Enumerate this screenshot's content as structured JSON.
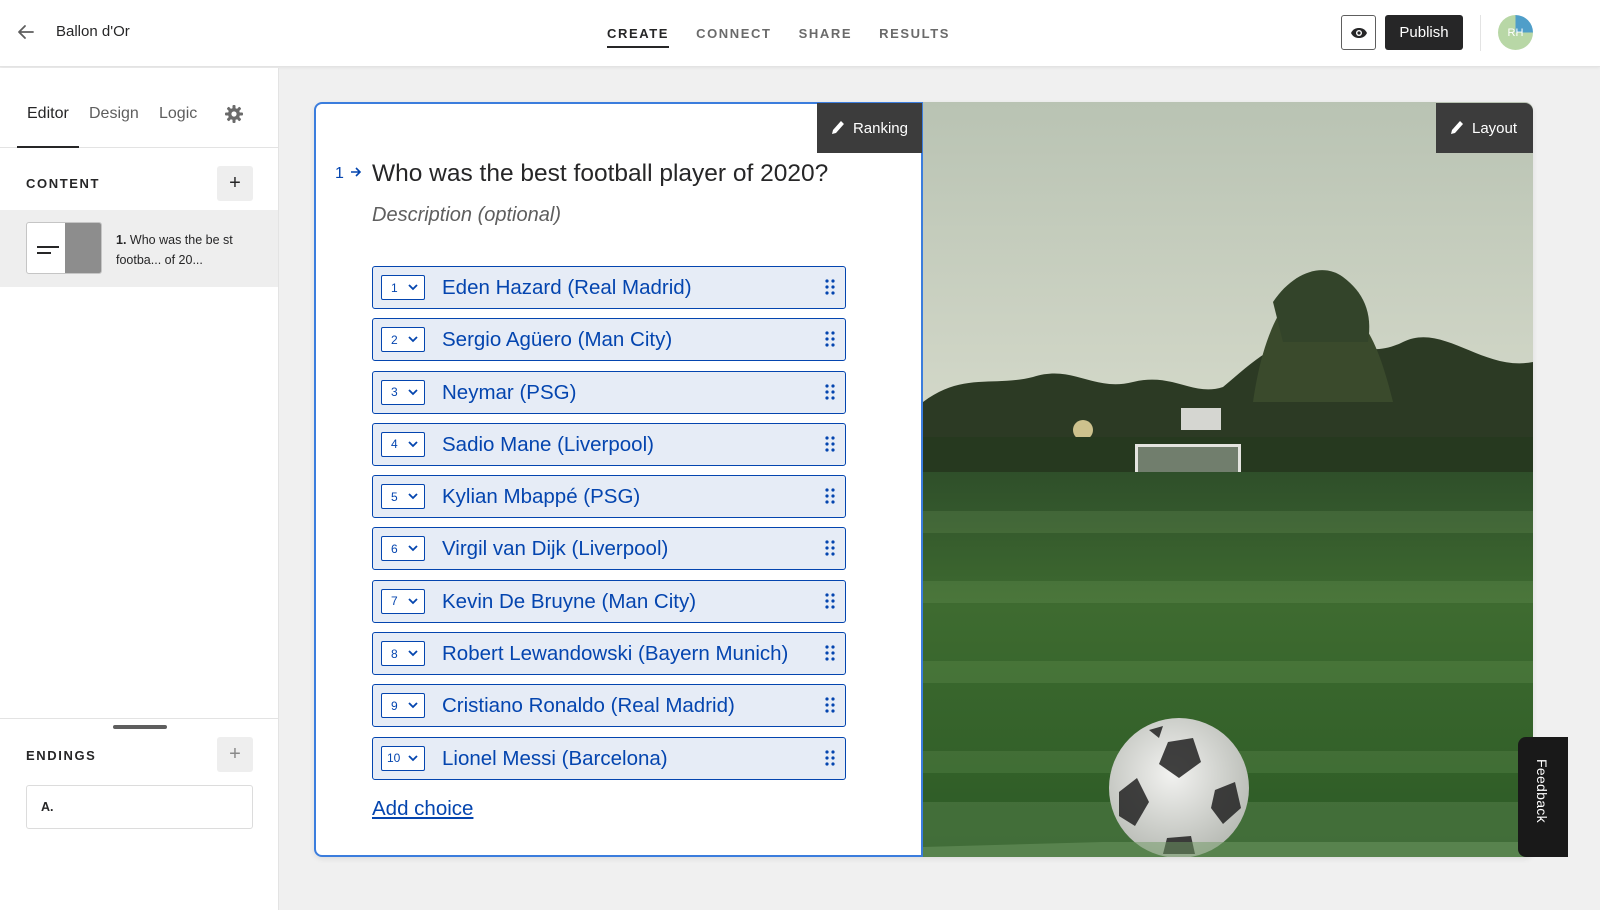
{
  "header": {
    "form_title": "Ballon d'Or",
    "nav_tabs": [
      {
        "label": "CREATE",
        "active": true
      },
      {
        "label": "CONNECT",
        "active": false
      },
      {
        "label": "SHARE",
        "active": false
      },
      {
        "label": "RESULTS",
        "active": false
      }
    ],
    "publish_label": "Publish",
    "avatar_initials": "RH"
  },
  "sidebar": {
    "tabs": [
      {
        "label": "Editor",
        "active": true
      },
      {
        "label": "Design",
        "active": false
      },
      {
        "label": "Logic",
        "active": false
      }
    ],
    "content_label": "CONTENT",
    "add_symbol": "+",
    "content_items": [
      {
        "number": "1.",
        "text": "Who was the be st footba... of 20..."
      }
    ],
    "endings_label": "ENDINGS",
    "endings": [
      {
        "label": "A."
      }
    ]
  },
  "question": {
    "number": "1",
    "title": "Who was the best football player of 2020?",
    "description_placeholder": "Description (optional)",
    "type_label": "Ranking",
    "layout_label": "Layout",
    "choices": [
      {
        "rank": "1",
        "label": "Eden Hazard (Real Madrid)"
      },
      {
        "rank": "2",
        "label": "Sergio Agüero (Man City)"
      },
      {
        "rank": "3",
        "label": "Neymar (PSG)"
      },
      {
        "rank": "4",
        "label": "Sadio Mane (Liverpool)"
      },
      {
        "rank": "5",
        "label": "Kylian Mbappé (PSG)"
      },
      {
        "rank": "6",
        "label": "Virgil van Dijk (Liverpool)"
      },
      {
        "rank": "7",
        "label": "Kevin De Bruyne (Man City)"
      },
      {
        "rank": "8",
        "label": "Robert Lewandowski (Bayern Munich)"
      },
      {
        "rank": "9",
        "label": "Cristiano Ronaldo (Real Madrid)"
      },
      {
        "rank": "10",
        "label": "Lionel Messi (Barcelona)"
      }
    ],
    "add_choice_label": "Add choice"
  },
  "feedback_label": "Feedback",
  "colors": {
    "accent": "#0445af",
    "choice_bg": "#e6ecf6",
    "selection_border": "#3b7ddd",
    "dark_button": "#262627"
  },
  "icons": {
    "back": "arrow-left-icon",
    "preview": "eye-icon",
    "settings": "gear-icon",
    "edit": "pencil-icon",
    "drag": "grip-icon",
    "dropdown": "chevron-down-icon"
  }
}
